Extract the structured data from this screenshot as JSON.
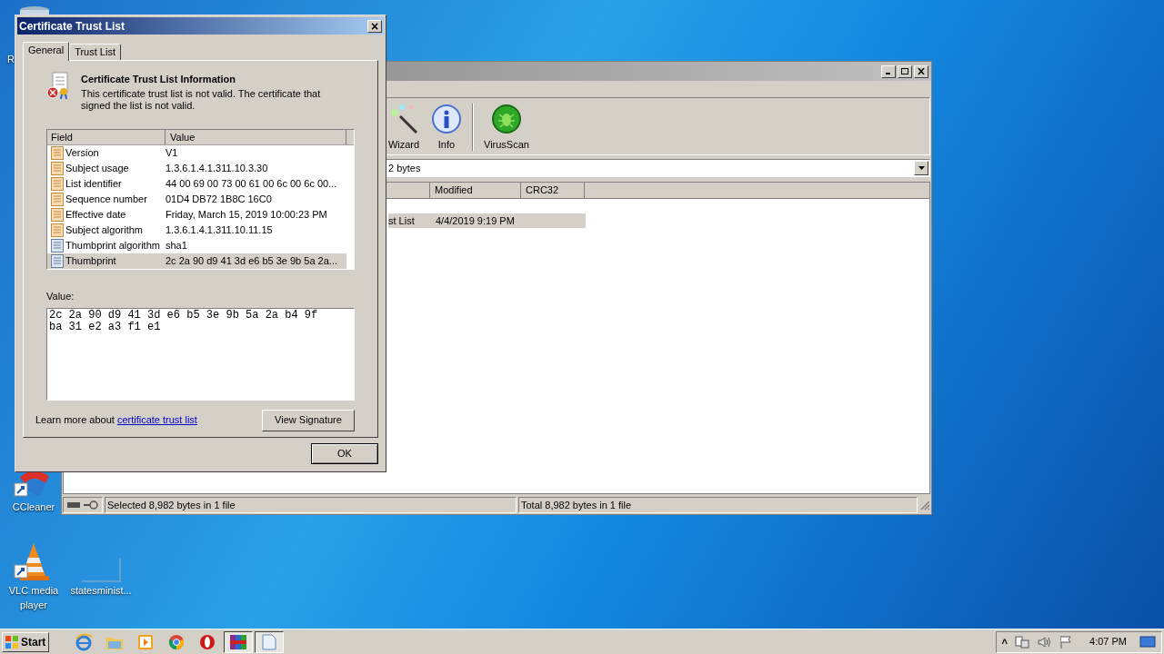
{
  "desktop_icons": [
    {
      "label": "R",
      "kind": "bin"
    },
    {
      "label": "CCleaner",
      "kind": "ccleaner"
    },
    {
      "label": "VLC media player",
      "kind": "vlc"
    },
    {
      "label": "statesminist...",
      "kind": "blank"
    }
  ],
  "back_window": {
    "toolbar": [
      {
        "label": "Wizard",
        "kind": "wand"
      },
      {
        "label": "Info",
        "kind": "info"
      },
      {
        "label": "VirusScan",
        "kind": "bug"
      }
    ],
    "address": "2 bytes",
    "columns": [
      "Modified",
      "CRC32"
    ],
    "rows": [
      {
        "name": "st List",
        "modified": "4/4/2019 9:19 PM",
        "selected": true
      }
    ],
    "status": [
      "Selected 8,982 bytes in 1 file",
      "Total 8,982 bytes in 1 file"
    ]
  },
  "dialog": {
    "title": "Certificate Trust List",
    "close": "×",
    "tabs": [
      {
        "label": "General",
        "selected": true
      },
      {
        "label": "Trust List",
        "selected": false
      }
    ],
    "heading": "Certificate Trust List Information",
    "message": "This certificate trust list is not valid.  The certificate that signed the list is not valid.",
    "columns": [
      "Field",
      "Value"
    ],
    "rows": [
      {
        "field": "Version",
        "value": "V1",
        "kind": "field",
        "selected": false
      },
      {
        "field": "Subject usage",
        "value": "1.3.6.1.4.1.311.10.3.30",
        "kind": "field",
        "selected": false
      },
      {
        "field": "List identifier",
        "value": "44 00 69 00 73 00 61 00 6c 00 6c 00...",
        "kind": "field",
        "selected": false
      },
      {
        "field": "Sequence number",
        "value": "01D4 DB72 1B8C 16C0",
        "kind": "field",
        "selected": false
      },
      {
        "field": "Effective date",
        "value": "Friday, March 15, 2019 10:00:23 PM",
        "kind": "field",
        "selected": false
      },
      {
        "field": "Subject algorithm",
        "value": "1.3.6.1.4.1.311.10.11.15",
        "kind": "field",
        "selected": false
      },
      {
        "field": "Thumbprint algorithm",
        "value": "sha1",
        "kind": "property",
        "selected": false
      },
      {
        "field": "Thumbprint",
        "value": "2c 2a 90 d9 41 3d e6 b5 3e 9b 5a 2a...",
        "kind": "property",
        "selected": true
      }
    ],
    "value_label": "Value:",
    "value_text": "2c 2a 90 d9 41 3d e6 b5 3e 9b 5a 2a b4 9f ba 31 e2 a3 f1 e1",
    "learn_more": "Learn more about",
    "link": "certificate trust list",
    "view_signature": "View Signature",
    "ok": "OK"
  },
  "taskbar": {
    "start": "Start",
    "items": [
      {
        "kind": "ie",
        "selected": false
      },
      {
        "kind": "folder",
        "selected": false
      },
      {
        "kind": "media",
        "selected": false
      },
      {
        "kind": "chrome",
        "selected": false
      },
      {
        "kind": "opera",
        "selected": false
      },
      {
        "kind": "archive",
        "selected": true
      },
      {
        "kind": "document",
        "selected": true
      }
    ],
    "tray_expand": "˄",
    "time": "4:07 PM"
  }
}
